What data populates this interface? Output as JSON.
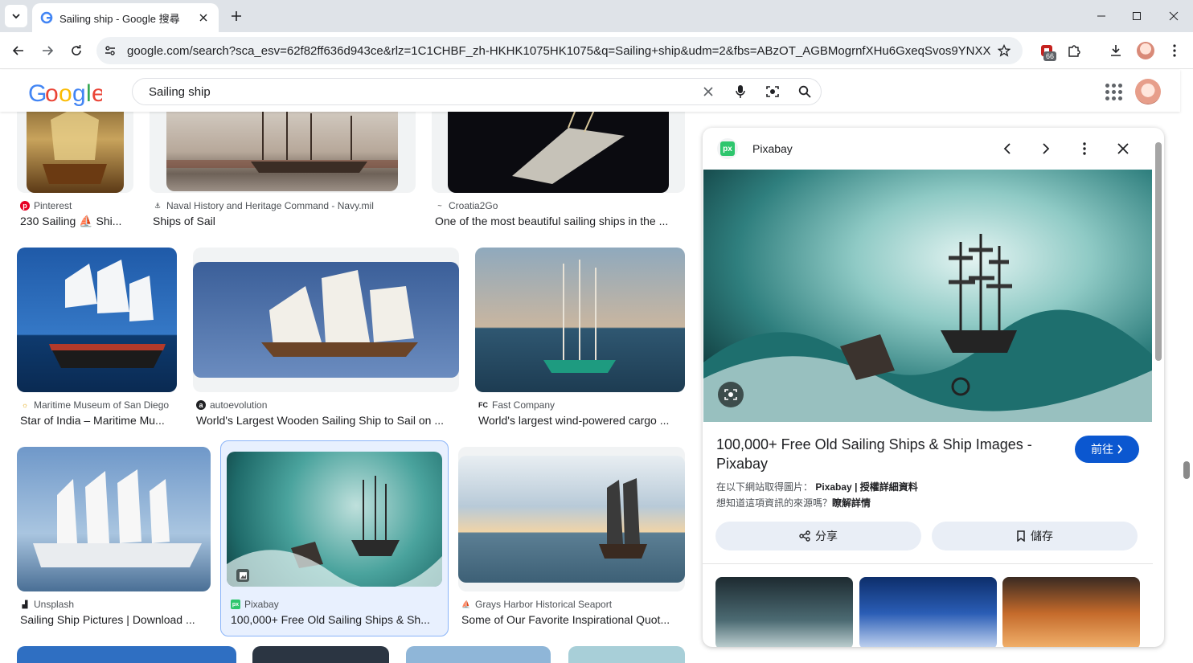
{
  "browser": {
    "tab_title": "Sailing ship - Google 搜尋",
    "url": "google.com/search?sca_esv=62f82ff636d943ce&rlz=1C1CHBF_zh-HKHK1075HK1075&q=Sailing+ship&udm=2&fbs=ABzOT_AGBMogrnfXHu6GxeqSvos9YNXX...",
    "extension_badge": "66"
  },
  "search": {
    "query": "Sailing ship"
  },
  "results": [
    {
      "source": "Pinterest",
      "title": "230 Sailing ⛵ Shi..."
    },
    {
      "source": "Naval History and Heritage Command - Navy.mil",
      "title": "Ships of Sail"
    },
    {
      "source": "Croatia2Go",
      "title": "One of the most beautiful sailing ships in the ..."
    },
    {
      "source": "Maritime Museum of San Diego",
      "title": "Star of India – Maritime Mu..."
    },
    {
      "source": "autoevolution",
      "title": "World's Largest Wooden Sailing Ship to Sail on ..."
    },
    {
      "source": "Fast Company",
      "title": "World's largest wind-powered cargo ..."
    },
    {
      "source": "Unsplash",
      "title": "Sailing Ship Pictures | Download ..."
    },
    {
      "source": "Pixabay",
      "title": "100,000+ Free Old Sailing Ships & Sh..."
    },
    {
      "source": "Grays Harbor Historical Seaport",
      "title": "Some of Our Favorite Inspirational Quot..."
    }
  ],
  "panel": {
    "site": "Pixabay",
    "title": "100,000+ Free Old Sailing Ships & Ship Images - Pixabay",
    "visit_label": "前往",
    "meta_prefix": "在以下網站取得圖片：",
    "meta_site": "Pixabay",
    "meta_sep": " | ",
    "meta_license": "授權詳細資料",
    "meta_question": "想知道這項資訊的來源嗎？",
    "meta_learn": "瞭解詳情",
    "share_label": "分享",
    "save_label": "儲存"
  },
  "colors": {
    "accent": "#0b57d0",
    "selected_bg": "#e8f0fe",
    "pixabay_green": "#2ec66d"
  }
}
